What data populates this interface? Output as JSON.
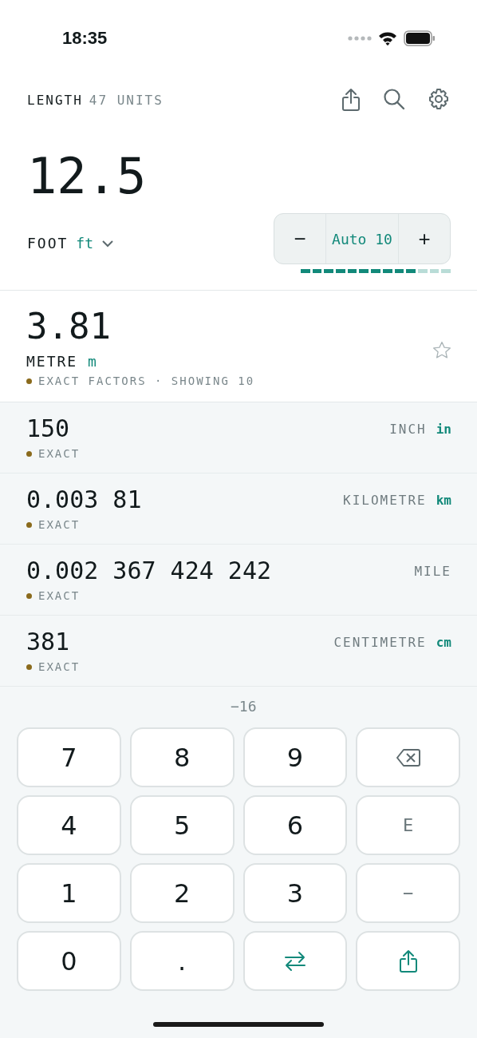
{
  "status_bar": {
    "time": "18:35"
  },
  "header": {
    "category": "LENGTH",
    "unit_count": "47 UNITS"
  },
  "input": {
    "value": "12.5",
    "unit_name": "FOOT",
    "unit_symbol": "ft"
  },
  "precision": {
    "minus": "−",
    "label": "Auto 10",
    "plus": "+",
    "level": 0.77
  },
  "primary_result": {
    "value": "3.81",
    "unit_name": "METRE",
    "unit_symbol": "m",
    "note": "EXACT FACTORS · SHOWING 10",
    "starred": false
  },
  "results": [
    {
      "value": "150",
      "unit_name": "INCH",
      "unit_symbol": "in",
      "note": "EXACT"
    },
    {
      "value": "0.003 81",
      "unit_name": "KILOMETRE",
      "unit_symbol": "km",
      "note": "EXACT"
    },
    {
      "value": "0.002 367 424 242",
      "unit_name": "MILE",
      "note": "EXACT"
    },
    {
      "value": "381",
      "unit_name": "CENTIMETRE",
      "unit_symbol": "cm",
      "note": "EXACT"
    },
    {
      "exponent": "−16"
    }
  ],
  "keypad": [
    {
      "kind": "digit",
      "label": "7"
    },
    {
      "kind": "digit",
      "label": "8"
    },
    {
      "kind": "digit",
      "label": "9"
    },
    {
      "kind": "backspace"
    },
    {
      "kind": "digit",
      "label": "4"
    },
    {
      "kind": "digit",
      "label": "5"
    },
    {
      "kind": "digit",
      "label": "6"
    },
    {
      "kind": "text",
      "label": "E"
    },
    {
      "kind": "digit",
      "label": "1"
    },
    {
      "kind": "digit",
      "label": "2"
    },
    {
      "kind": "digit",
      "label": "3"
    },
    {
      "kind": "text",
      "label": "−"
    },
    {
      "kind": "digit",
      "label": "0"
    },
    {
      "kind": "digit",
      "label": "."
    },
    {
      "kind": "swap"
    },
    {
      "kind": "share"
    }
  ]
}
